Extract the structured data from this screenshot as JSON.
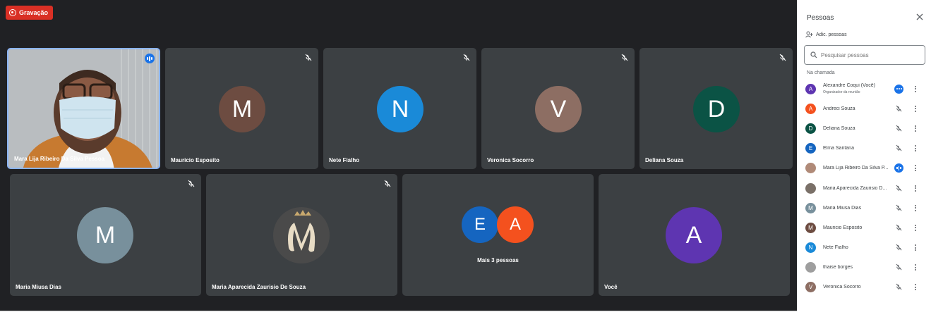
{
  "recording": {
    "label": "Gravação"
  },
  "tiles_row1": [
    {
      "name": "Mara Lija Ribeiro Da Silva Pessoa",
      "type": "video",
      "speaking": true
    },
    {
      "name": "Mauricio Esposito",
      "initial": "M",
      "color": "#6d4c41",
      "muted": true
    },
    {
      "name": "Nete Fialho",
      "initial": "N",
      "color": "#1a8ad8",
      "muted": true
    },
    {
      "name": "Veronica Socorro",
      "initial": "V",
      "color": "#8d6e63",
      "muted": true
    },
    {
      "name": "Deliana Souza",
      "initial": "D",
      "color": "#0b5345",
      "muted": true
    }
  ],
  "tiles_row2": [
    {
      "name": "Maria Miusa Dias",
      "initial": "M",
      "color": "#78909c",
      "muted": true
    },
    {
      "name": "Maria Aparecida Zaurisio De Souza",
      "type": "logo",
      "muted": true
    },
    {
      "group_label": "Mais 3 pessoas",
      "initials": [
        "E",
        "A"
      ],
      "colors": [
        "#1565c0",
        "#f4511e"
      ]
    },
    {
      "name": "Você",
      "initial": "A",
      "color": "#5e35b1"
    }
  ],
  "panel": {
    "title": "Pessoas",
    "add_people": "Adic. pessoas",
    "search_placeholder": "Pesquisar pessoas",
    "section_label": "Na chamada",
    "people": [
      {
        "name": "Alexandre Coqui (Você)",
        "subtitle": "Organizador da reunião",
        "initial": "A",
        "color": "#5e35b1",
        "status": "more"
      },
      {
        "name": "Andreci Souza",
        "initial": "A",
        "color": "#f4511e",
        "status": "muted"
      },
      {
        "name": "Deliana Souza",
        "initial": "D",
        "color": "#0b5345",
        "status": "muted"
      },
      {
        "name": "Elma Santana",
        "initial": "E",
        "color": "#1565c0",
        "status": "muted"
      },
      {
        "name": "Mara Lija Ribeiro Da Silva P...",
        "initial": "",
        "color": "#b08a78",
        "status": "speaking",
        "photo": true
      },
      {
        "name": "Maria Aparecida Zaurisio D...",
        "initial": "",
        "color": "#7a7068",
        "status": "muted",
        "photo": true
      },
      {
        "name": "Maria Miusa Dias",
        "initial": "M",
        "color": "#78909c",
        "status": "muted"
      },
      {
        "name": "Mauricio Esposito",
        "initial": "M",
        "color": "#6d4c41",
        "status": "muted"
      },
      {
        "name": "Nete Fialho",
        "initial": "N",
        "color": "#1a8ad8",
        "status": "muted"
      },
      {
        "name": "thaise borges",
        "initial": "",
        "color": "#9e9e9e",
        "status": "muted",
        "photo": true
      },
      {
        "name": "Veronica Socorro",
        "initial": "V",
        "color": "#8d6e63",
        "status": "muted"
      }
    ]
  }
}
